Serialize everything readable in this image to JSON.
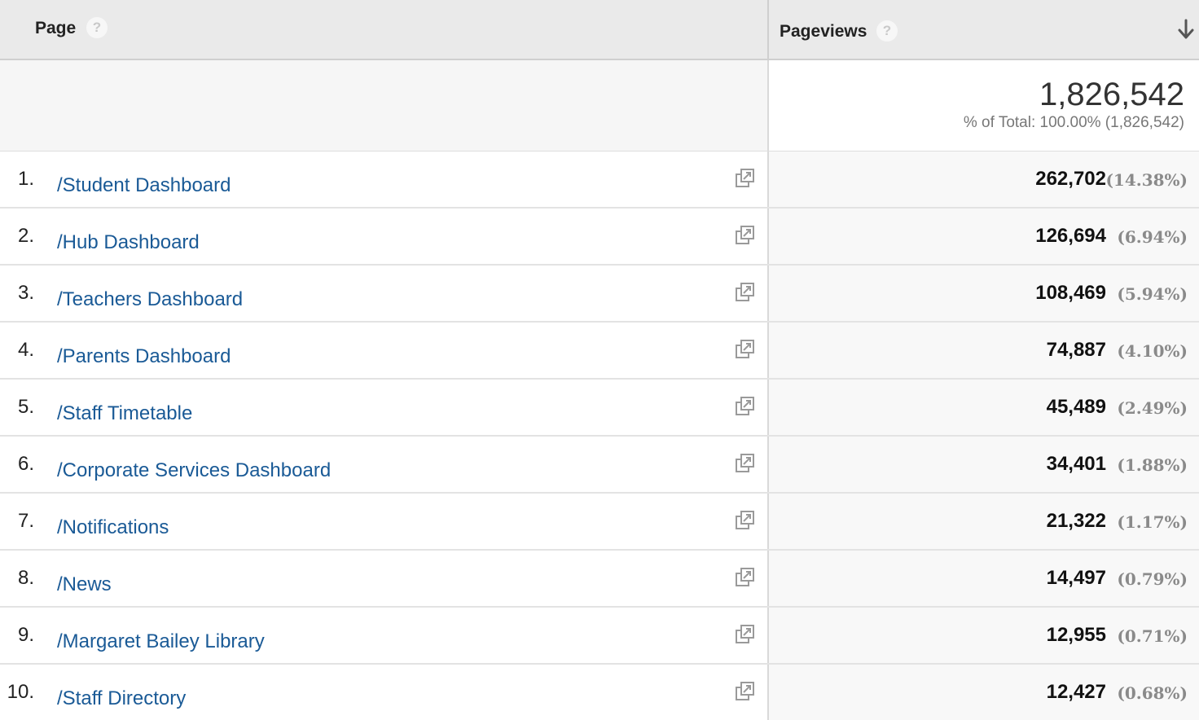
{
  "header": {
    "page_label": "Page",
    "metric_label": "Pageviews",
    "help_glyph": "?",
    "sort_icon": "arrow-down-icon"
  },
  "totals": {
    "value": "1,826,542",
    "subtitle": "% of Total: 100.00% (1,826,542)"
  },
  "rows": [
    {
      "rank": "1.",
      "page": "/Student Dashboard",
      "pageviews": "262,702",
      "percent": "(14.38%)"
    },
    {
      "rank": "2.",
      "page": "/Hub Dashboard",
      "pageviews": "126,694",
      "percent": "(6.94%)"
    },
    {
      "rank": "3.",
      "page": "/Teachers Dashboard",
      "pageviews": "108,469",
      "percent": "(5.94%)"
    },
    {
      "rank": "4.",
      "page": "/Parents Dashboard",
      "pageviews": "74,887",
      "percent": "(4.10%)"
    },
    {
      "rank": "5.",
      "page": "/Staff Timetable",
      "pageviews": "45,489",
      "percent": "(2.49%)"
    },
    {
      "rank": "6.",
      "page": "/Corporate Services Dashboard",
      "pageviews": "34,401",
      "percent": "(1.88%)"
    },
    {
      "rank": "7.",
      "page": "/Notifications",
      "pageviews": "21,322",
      "percent": "(1.17%)"
    },
    {
      "rank": "8.",
      "page": "/News",
      "pageviews": "14,497",
      "percent": "(0.79%)"
    },
    {
      "rank": "9.",
      "page": "/Margaret Bailey Library",
      "pageviews": "12,955",
      "percent": "(0.71%)"
    },
    {
      "rank": "10.",
      "page": "/Staff Directory",
      "pageviews": "12,427",
      "percent": "(0.68%)"
    }
  ],
  "colors": {
    "link": "#1a5a96",
    "header_bg": "#eaeaea",
    "percent_text": "#8a8a8a"
  }
}
